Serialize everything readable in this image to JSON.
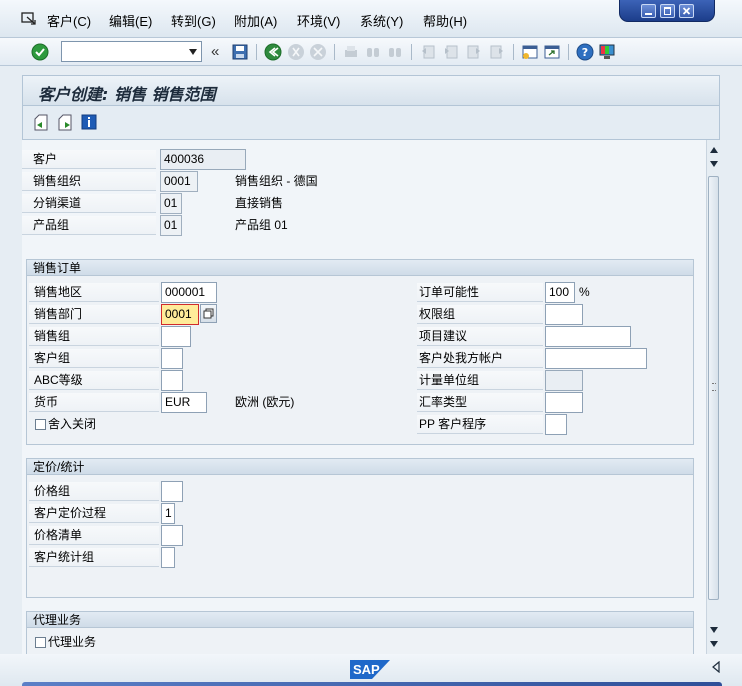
{
  "menu": {
    "items": [
      "客户(C)",
      "编辑(E)",
      "转到(G)",
      "附加(A)",
      "环境(V)",
      "系统(Y)",
      "帮助(H)"
    ]
  },
  "toolbar": {
    "command_value": "",
    "back_label": "«"
  },
  "screen": {
    "title": "客户创建: 销售 销售范围"
  },
  "header_fields": [
    {
      "label": "客户",
      "value": "400036",
      "desc": ""
    },
    {
      "label": "销售组织",
      "value": "0001",
      "desc": "销售组织 - 德国"
    },
    {
      "label": "分销渠道",
      "value": "01",
      "desc": "直接销售"
    },
    {
      "label": "产品组",
      "value": "01",
      "desc": "产品组 01"
    }
  ],
  "sales_order": {
    "header": "销售订单",
    "left": [
      {
        "label": "销售地区",
        "value": "000001",
        "desc": ""
      },
      {
        "label": "销售部门",
        "value": "0001",
        "desc": ""
      },
      {
        "label": "销售组",
        "value": "",
        "desc": ""
      },
      {
        "label": "客户组",
        "value": "",
        "desc": ""
      },
      {
        "label": "ABC等级",
        "value": "",
        "desc": ""
      },
      {
        "label": "货币",
        "value": "EUR",
        "desc": "欧洲 (欧元)"
      }
    ],
    "checkbox_label": "舍入关闭",
    "right": [
      {
        "label": "订单可能性",
        "value": "100",
        "unit": "%"
      },
      {
        "label": "权限组",
        "value": ""
      },
      {
        "label": "项目建议",
        "value": ""
      },
      {
        "label": "客户处我方帐户",
        "value": ""
      },
      {
        "label": "计量单位组",
        "value": ""
      },
      {
        "label": "汇率类型",
        "value": ""
      },
      {
        "label": "PP 客户程序",
        "value": ""
      }
    ]
  },
  "pricing": {
    "header": "定价/统计",
    "rows": [
      {
        "label": "价格组",
        "value": ""
      },
      {
        "label": "客户定价过程",
        "value": "1"
      },
      {
        "label": "价格清单",
        "value": ""
      },
      {
        "label": "客户统计组",
        "value": ""
      }
    ]
  },
  "agency": {
    "header": "代理业务",
    "checkbox_label": "代理业务"
  },
  "status": {
    "logo_text": "SAP"
  },
  "colors": {
    "focus_bg": "#ffec9a",
    "focus_border": "#d02c2c",
    "window_ctrl": "#2a4da0"
  }
}
